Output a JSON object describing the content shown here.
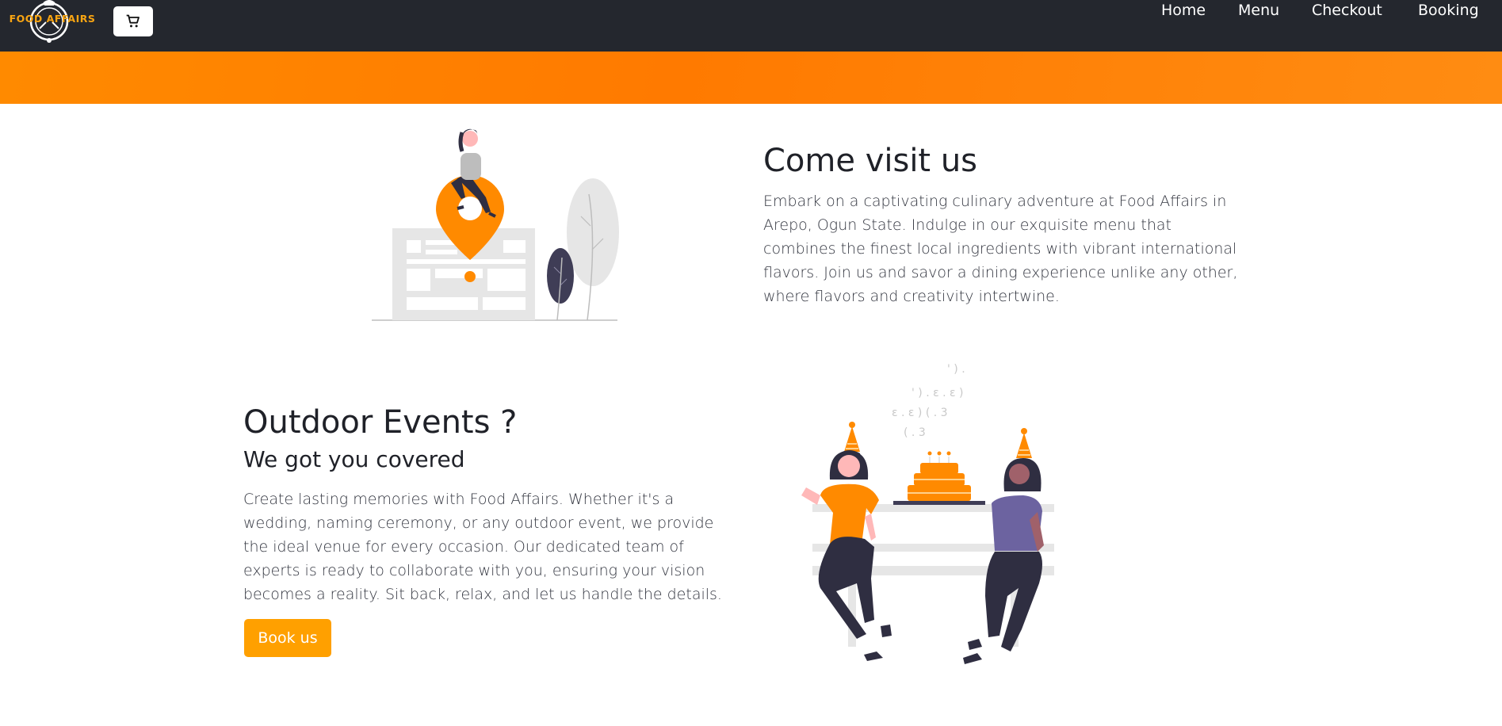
{
  "brand": {
    "logo_text": "FOOD AFFAIRS",
    "accent": "#f9a512"
  },
  "header": {
    "cart_icon": "cart-icon",
    "nav": [
      {
        "label": "Home"
      },
      {
        "label": "Menu"
      },
      {
        "label": "Checkout"
      },
      {
        "label": "Booking"
      }
    ]
  },
  "visit": {
    "title": "Come visit us",
    "text": "Embark on a captivating culinary adventure at Food Affairs in Arepo, Ogun State. Indulge in our exquisite menu that combines the finest local ingredients with vibrant international flavors. Join us and savor a dining experience unlike any other, where flavors and creativity intertwine."
  },
  "events": {
    "title": "Outdoor Events ?",
    "subtitle": "We got you covered",
    "text": "Create lasting memories with Food Affairs. Whether it's a wedding, naming ceremony, or any outdoor event, we provide the ideal venue for every occasion. Our dedicated team of experts is ready to collaborate with you, ensuring your vision becomes a reality. Sit back, relax, and let us handle the details.",
    "button_label": "Book us"
  },
  "colors": {
    "navbar": "#24272e",
    "banner": "#ff8000",
    "button": "#ffa000",
    "illustration_orange": "#ff8a00",
    "illustration_dark": "#2f2e41"
  }
}
